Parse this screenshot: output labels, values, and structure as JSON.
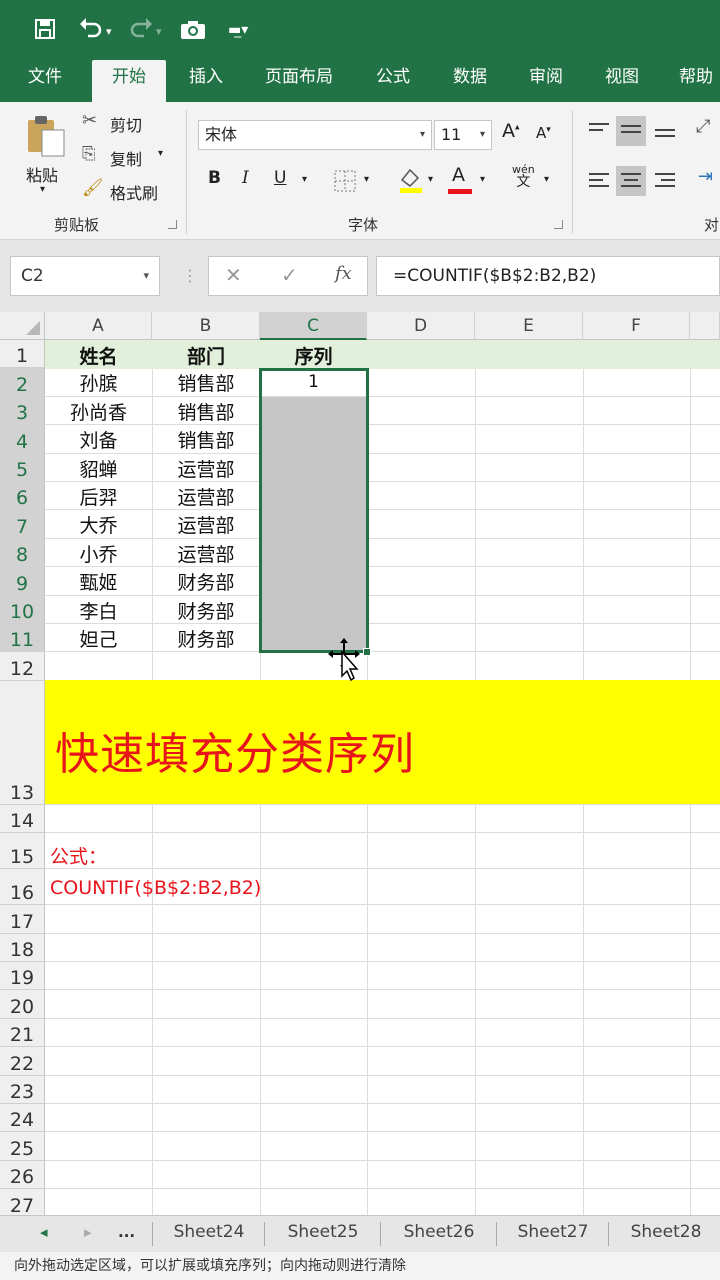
{
  "qat": {
    "save_icon": "save-icon",
    "undo_icon": "undo-icon",
    "redo_icon": "redo-icon",
    "camera_icon": "camera-icon",
    "customize_icon": "customize-icon"
  },
  "tabs": [
    "文件",
    "开始",
    "插入",
    "页面布局",
    "公式",
    "数据",
    "审阅",
    "视图",
    "帮助"
  ],
  "active_tab": "开始",
  "ribbon": {
    "paste": "粘贴",
    "cut": "剪切",
    "copy": "复制",
    "format_painter": "格式刷",
    "clipboard_group": "剪贴板",
    "font_name": "宋体",
    "font_size": "11",
    "increase_font": "A",
    "decrease_font": "A",
    "bold": "B",
    "italic": "I",
    "underline": "U",
    "font_group": "字体",
    "pinyin": "wén",
    "pinyin_char": "文",
    "font_color_letter": "A",
    "align_group_partial": "对"
  },
  "formula_bar": {
    "name_box": "C2",
    "cancel": "✕",
    "enter": "✓",
    "fx": "fx",
    "formula": "=COUNTIF($B$2:B2,B2)"
  },
  "columns": [
    "A",
    "B",
    "C",
    "D",
    "E",
    "F"
  ],
  "rows": [
    "1",
    "2",
    "3",
    "4",
    "5",
    "6",
    "7",
    "8",
    "9",
    "10",
    "11",
    "12",
    "13",
    "14",
    "15",
    "16",
    "17",
    "18",
    "19",
    "20",
    "21",
    "22",
    "23",
    "24",
    "25",
    "26",
    "27"
  ],
  "table": {
    "headers": [
      "姓名",
      "部门",
      "序列"
    ],
    "names": [
      "孙膑",
      "孙尚香",
      "刘备",
      "貂蝉",
      "后羿",
      "大乔",
      "小乔",
      "甄姬",
      "李白",
      "妲己"
    ],
    "depts": [
      "销售部",
      "销售部",
      "销售部",
      "运营部",
      "运营部",
      "运营部",
      "运营部",
      "财务部",
      "财务部",
      "财务部"
    ],
    "c2_value": "1"
  },
  "banner": {
    "text": "快速填充分类序列",
    "bg_color": "#ffff00",
    "text_color": "#e8141c"
  },
  "notes": {
    "label": "公式：",
    "formula": "COUNTIF($B$2:B2,B2)"
  },
  "sheet_tabs": [
    "Sheet24",
    "Sheet25",
    "Sheet26",
    "Sheet27",
    "Sheet28"
  ],
  "sheet_nav": {
    "prev": "◂",
    "next": "▸",
    "more": "..."
  },
  "status_bar": "向外拖动选定区域，可以扩展或填充序列；向内拖动则进行清除",
  "accent_color": "#217346"
}
